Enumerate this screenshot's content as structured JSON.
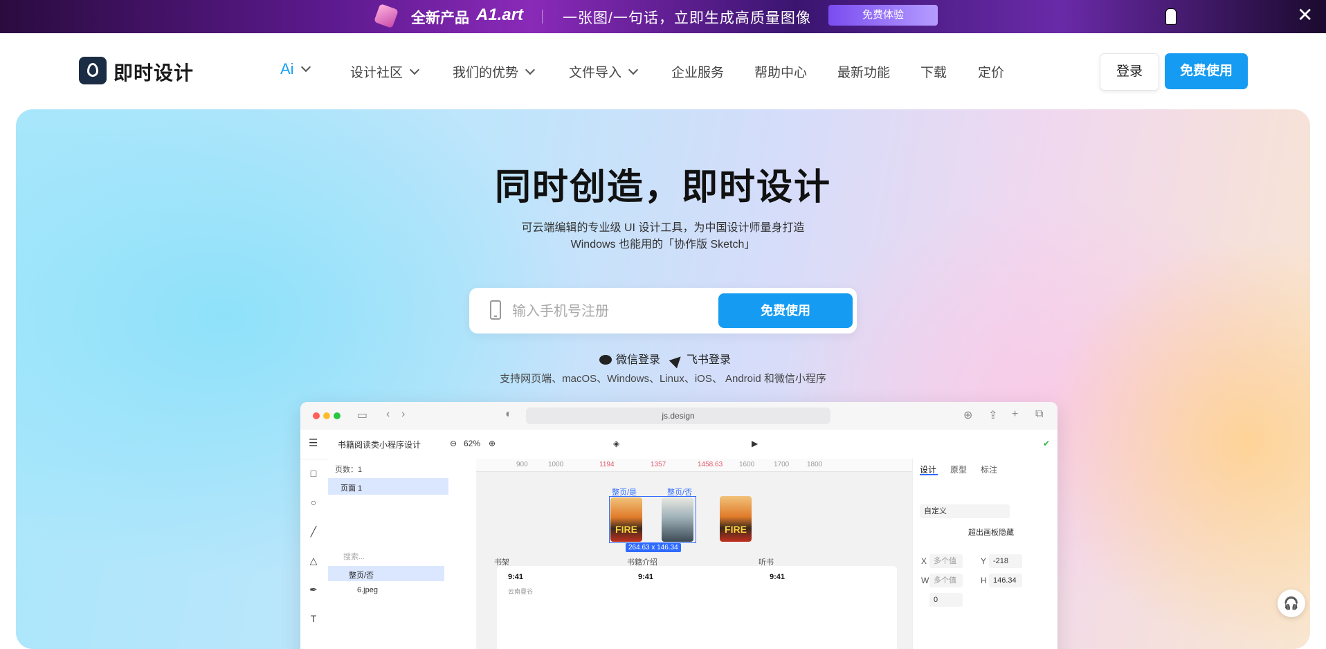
{
  "promo": {
    "product_label": "全新产品",
    "product_name": "A1.art",
    "tagline": "一张图/一句话，立即生成高质量图像",
    "cta": "免费体验",
    "close_glyph": "✕"
  },
  "nav": {
    "logo_text": "即时设计",
    "items": [
      {
        "label": "Ai",
        "dropdown": true
      },
      {
        "label": "设计社区",
        "dropdown": true
      },
      {
        "label": "我们的优势",
        "dropdown": true
      },
      {
        "label": "文件导入",
        "dropdown": true
      },
      {
        "label": "企业服务",
        "dropdown": false
      },
      {
        "label": "帮助中心",
        "dropdown": false
      },
      {
        "label": "最新功能",
        "dropdown": false
      },
      {
        "label": "下载",
        "dropdown": false
      },
      {
        "label": "定价",
        "dropdown": false
      }
    ],
    "login": "登录",
    "free_use": "免费使用"
  },
  "hero": {
    "title": "同时创造，即时设计",
    "sub_line1": "可云端编辑的专业级 UI 设计工具，为中国设计师量身打造",
    "sub_line2": "Windows 也能用的「协作版 Sketch」",
    "phone_placeholder": "输入手机号注册",
    "signup_button": "免费使用",
    "wechat_login": "微信登录",
    "feishu_login": "飞书登录",
    "platforms": "支持网页端、macOS、Windows、Linux、iOS、 Android 和微信小程序"
  },
  "app": {
    "url": "js.design",
    "file_name": "书籍阅读类小程序设计",
    "zoom": "62%",
    "pages_label": "页数：1",
    "page_1": "页面 1",
    "layer_search_placeholder": "搜索...",
    "layer_group": "整页/否",
    "layer_image": "6.jpeg",
    "ruler_ticks": [
      "900",
      "1000",
      "1194",
      "1357",
      "1458.63",
      "1600",
      "1700",
      "1800"
    ],
    "frame_label_1": "整页/是",
    "frame_label_2": "整页/否",
    "dimension_badge": "264.63 x 146.34",
    "fire_text": "FIRE",
    "frame_shelf": "书架",
    "frame_intro": "书籍介绍",
    "frame_listen": "听书",
    "status_time": "9:41",
    "search_hint": "云南曼谷",
    "prop_tabs": [
      "设计",
      "原型",
      "标注"
    ],
    "frame_preset": "自定义",
    "clip_content": "超出画板隐藏",
    "x_label": "X",
    "x_value": "多个值",
    "y_label": "Y",
    "y_value": "-218",
    "w_label": "W",
    "w_value": "多个值",
    "h_label": "H",
    "h_value": "146.34",
    "rotation_value": "0"
  },
  "colors": {
    "brand": "#159cf2",
    "promo_button": "#8f6cf5"
  }
}
